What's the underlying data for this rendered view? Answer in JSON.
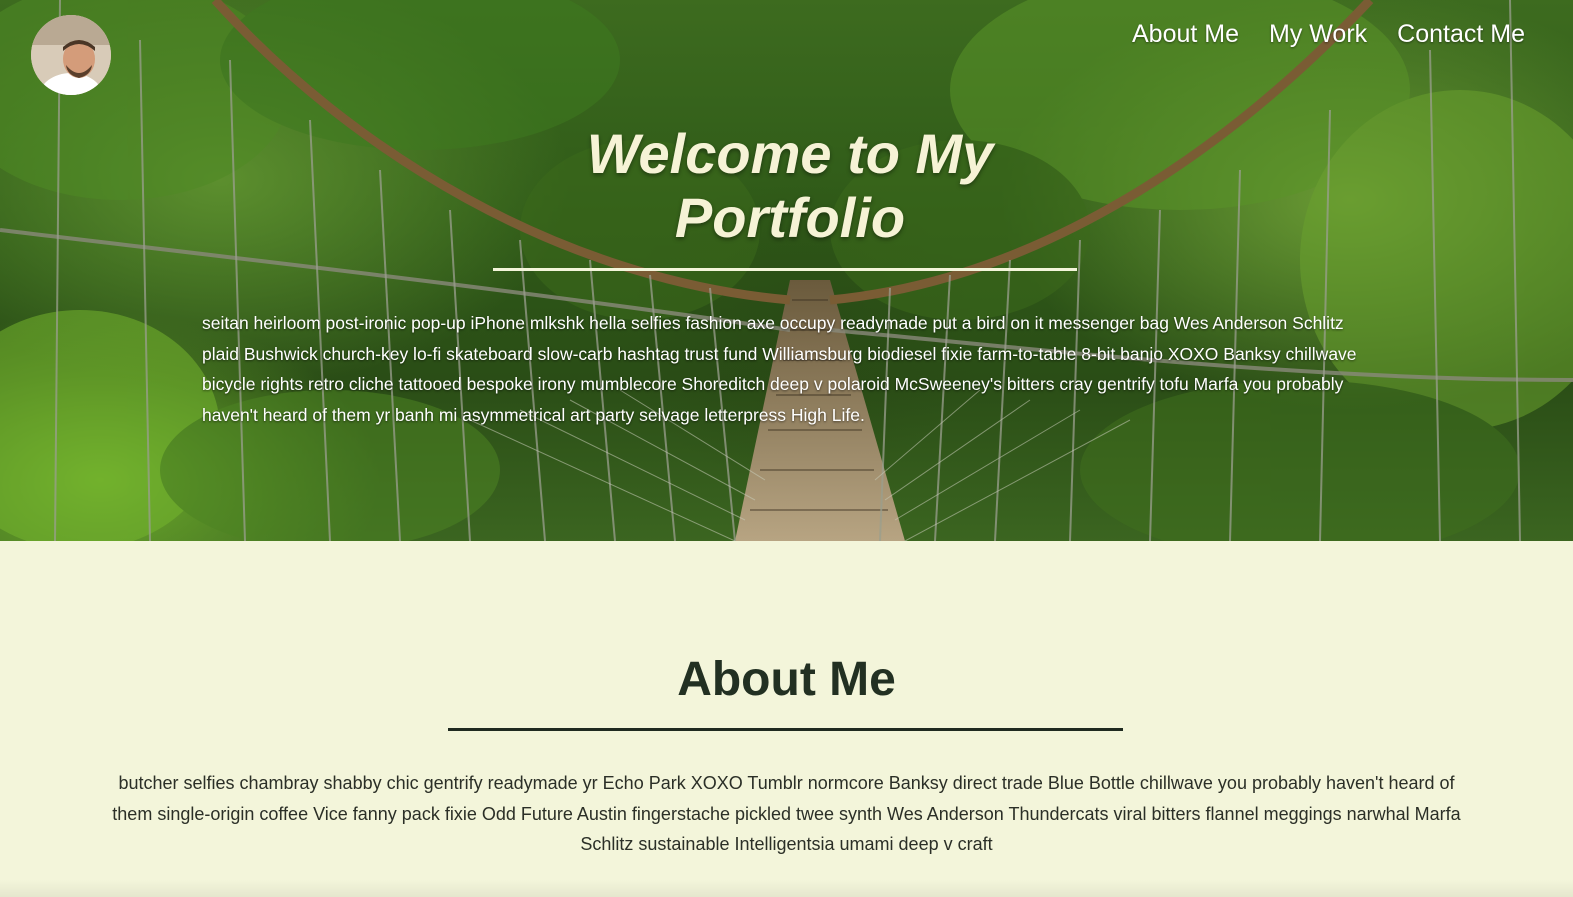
{
  "nav": {
    "about": "About Me",
    "work": "My Work",
    "contact": "Contact Me"
  },
  "hero": {
    "title": "Welcome to My Portfolio",
    "text": "seitan heirloom post-ironic pop-up iPhone mlkshk hella selfies fashion axe occupy readymade put a bird on it messenger bag Wes Anderson Schlitz plaid Bushwick church-key lo-fi skateboard slow-carb hashtag trust fund Williamsburg biodiesel fixie farm-to-table 8-bit banjo XOXO Banksy chillwave bicycle rights retro cliche tattooed bespoke irony mumblecore Shoreditch deep v polaroid McSweeney's bitters cray gentrify tofu Marfa you probably haven't heard of them yr banh mi asymmetrical art party selvage letterpress High Life."
  },
  "about": {
    "title": "About Me",
    "text": "butcher selfies chambray shabby chic gentrify readymade yr Echo Park XOXO Tumblr normcore Banksy direct trade Blue Bottle chillwave you probably haven't heard of them single-origin coffee Vice fanny pack fixie Odd Future Austin fingerstache pickled twee synth Wes Anderson Thundercats viral bitters flannel meggings narwhal Marfa Schlitz sustainable Intelligentsia umami deep v craft"
  },
  "colors": {
    "page_background": "#f3f5da",
    "heading_dark": "#223022",
    "hero_title": "#f6f3d6"
  }
}
